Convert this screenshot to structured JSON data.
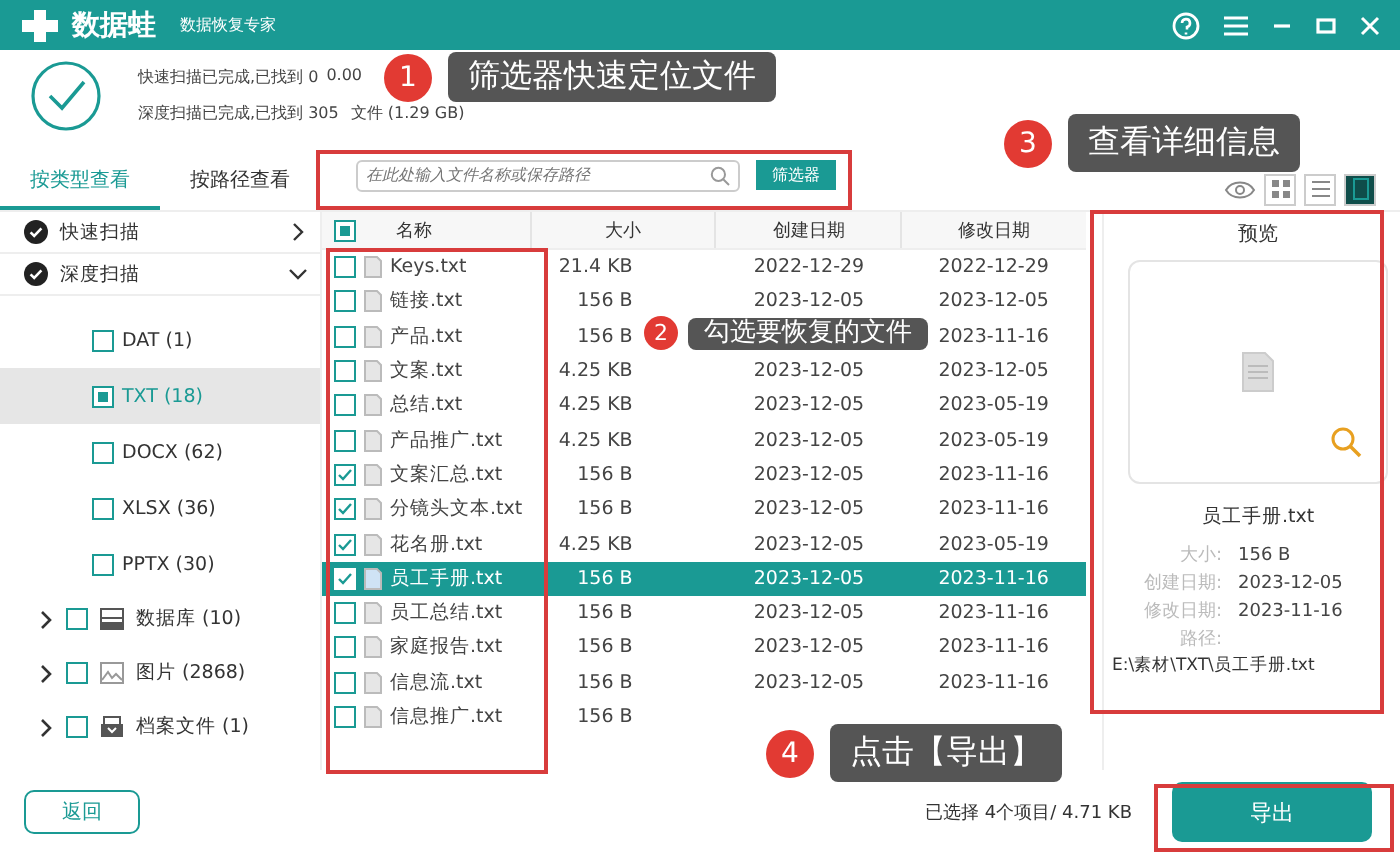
{
  "window": {
    "app_name": "数据蛙",
    "subtitle": "数据恢复专家"
  },
  "scan_status": {
    "quick": "快速扫描已完成,已找到 0",
    "quick_tail": "0.00",
    "deep": "深度扫描已完成,已找到 305",
    "deep_tail": "文件 (1.29 GB)"
  },
  "view_tabs": [
    {
      "label": "按类型查看",
      "selected": true
    },
    {
      "label": "按路径查看",
      "selected": false
    }
  ],
  "search": {
    "placeholder": "在此处输入文件名称或保存路径"
  },
  "filter_button": "筛选器",
  "view_modes": [
    {
      "kind": "grid",
      "selected": false
    },
    {
      "kind": "list",
      "selected": false
    },
    {
      "kind": "detail",
      "selected": true
    }
  ],
  "scan_groups": [
    {
      "label": "快速扫描",
      "expanded": false
    },
    {
      "label": "深度扫描",
      "expanded": true
    }
  ],
  "file_types": [
    {
      "label": "DAT (1)",
      "partial": false,
      "selected": false
    },
    {
      "label": "TXT (18)",
      "partial": true,
      "selected": true
    },
    {
      "label": "DOCX (62)",
      "partial": false,
      "selected": false
    },
    {
      "label": "XLSX (36)",
      "partial": false,
      "selected": false
    },
    {
      "label": "PPTX (30)",
      "partial": false,
      "selected": false
    }
  ],
  "categories": [
    {
      "label": "数据库 (10)",
      "kind": "database",
      "checked": false
    },
    {
      "label": "图片 (2868)",
      "kind": "image",
      "checked": false
    },
    {
      "label": "档案文件 (1)",
      "kind": "archive",
      "checked": false
    }
  ],
  "table": {
    "columns": [
      "名称",
      "大小",
      "创建日期",
      "修改日期"
    ],
    "header_partial": true,
    "rows": [
      {
        "name": "Keys.txt",
        "size": "21.4 KB",
        "created": "2022-12-29",
        "modified": "2022-12-29",
        "checked": false,
        "selected": false
      },
      {
        "name": "链接.txt",
        "size": "156  B",
        "created": "2023-12-05",
        "modified": "2023-12-05",
        "checked": false,
        "selected": false
      },
      {
        "name": "产品.txt",
        "size": "156  B",
        "modified": "2023-11-16",
        "checked": false,
        "selected": false
      },
      {
        "name": "文案.txt",
        "size": "4.25 KB",
        "created": "2023-12-05",
        "modified": "2023-12-05",
        "checked": false,
        "selected": false
      },
      {
        "name": "总结.txt",
        "size": "4.25 KB",
        "created": "2023-12-05",
        "modified": "2023-05-19",
        "checked": false,
        "selected": false
      },
      {
        "name": "产品推广.txt",
        "size": "4.25 KB",
        "created": "2023-12-05",
        "modified": "2023-05-19",
        "checked": false,
        "selected": false
      },
      {
        "name": "文案汇总.txt",
        "size": "156  B",
        "created": "2023-12-05",
        "modified": "2023-11-16",
        "checked": true,
        "selected": false
      },
      {
        "name": "分镜头文本.txt",
        "size": "156  B",
        "created": "2023-12-05",
        "modified": "2023-11-16",
        "checked": true,
        "selected": false
      },
      {
        "name": "花名册.txt",
        "size": "4.25 KB",
        "created": "2023-12-05",
        "modified": "2023-05-19",
        "checked": true,
        "selected": false
      },
      {
        "name": "员工手册.txt",
        "size": "156  B",
        "created": "2023-12-05",
        "modified": "2023-11-16",
        "checked": true,
        "selected": true
      },
      {
        "name": "员工总结.txt",
        "size": "156  B",
        "created": "2023-12-05",
        "modified": "2023-11-16",
        "checked": false,
        "selected": false
      },
      {
        "name": "家庭报告.txt",
        "size": "156  B",
        "created": "2023-12-05",
        "modified": "2023-11-16",
        "checked": false,
        "selected": false
      },
      {
        "name": "信息流.txt",
        "size": "156  B",
        "created": "2023-12-05",
        "modified": "2023-11-16",
        "checked": false,
        "selected": false
      },
      {
        "name": "信息推广.txt",
        "size": "156  B",
        "checked": false,
        "selected": false
      }
    ]
  },
  "preview": {
    "title": "预览",
    "file_name": "员工手册.txt",
    "fields": [
      {
        "label": "大小:",
        "value": "156  B"
      },
      {
        "label": "创建日期:",
        "value": "2023-12-05"
      },
      {
        "label": "修改日期:",
        "value": "2023-11-16"
      }
    ],
    "path_label": "路径:",
    "path": "E:\\素材\\TXT\\员工手册.txt"
  },
  "back_button": "返回",
  "selection_summary": "已选择 4个项目/ 4.71 KB",
  "export_button": "导出",
  "callouts": [
    {
      "number": "1",
      "text": "筛选器快速定位文件"
    },
    {
      "number": "2",
      "text": "勾选要恢复的文件"
    },
    {
      "number": "3",
      "text": "查看详细信息"
    },
    {
      "number": "4",
      "text": "点击【导出】"
    }
  ]
}
